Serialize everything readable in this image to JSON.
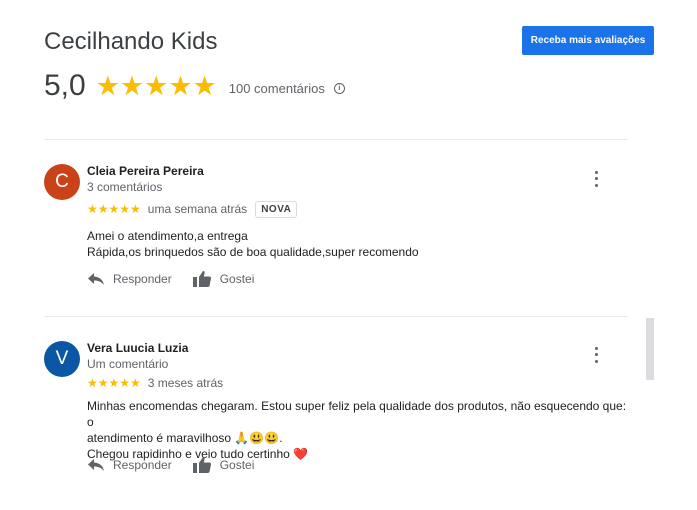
{
  "header": {
    "title": "Cecilhando Kids",
    "get_reviews_button": "Receba mais avaliações",
    "rating_value": "5,0",
    "stars": "★★★★★",
    "review_count": "100 comentários",
    "info_icon_glyph": "i"
  },
  "reviews": [
    {
      "avatar_letter": "C",
      "avatar_color": "#c9421a",
      "name": "Cleia Pereira Pereira",
      "meta": "3 comentários",
      "stars": "★★★★★",
      "date": "uma semana atrás",
      "badge": "NOVA",
      "text_lines": [
        "Amei o atendimento,a entrega",
        "Rápida,os brinquedos são de boa qualidade,super recomendo"
      ],
      "reply_label": "Responder",
      "like_label": "Gostei"
    },
    {
      "avatar_letter": "V",
      "avatar_color": "#0b57a4",
      "name": "Vera Luucia Luzia",
      "meta": "Um comentário",
      "stars": "★★★★★",
      "date": "3 meses atrás",
      "text_lines": [
        "Minhas encomendas chegaram. Estou super feliz pela qualidade dos produtos, não esquecendo que: o",
        "atendimento é maravilhoso 🙏😃😃.",
        "Chegou rapidinho e veio tudo certinho ❤️"
      ],
      "reply_label": "Responder",
      "like_label": "Gostei"
    }
  ],
  "colors": {
    "accent": "#1a73e8",
    "star": "#fbbc04"
  }
}
